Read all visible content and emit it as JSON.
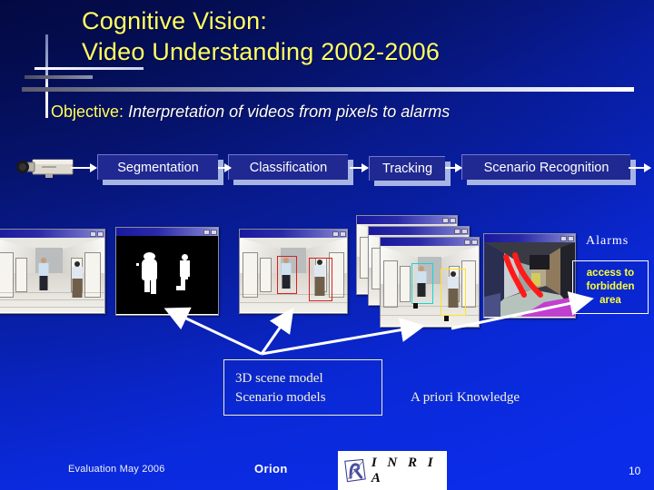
{
  "slide": {
    "title_line1": "Cognitive Vision:",
    "title_line2": "Video Understanding 2002-2006",
    "objective_label": "Objective:",
    "objective_value": "Interpretation of videos from pixels to alarms",
    "background_color": "#0a1f9b",
    "title_color": "#ffff66"
  },
  "pipeline": {
    "source_icon": "video-camera-icon",
    "stages": [
      {
        "label": "Segmentation"
      },
      {
        "label": "Classification"
      },
      {
        "label": "Tracking"
      },
      {
        "label": "Scenario Recognition"
      }
    ]
  },
  "frames": [
    {
      "name": "segmentation-input-frame",
      "caption": "corridor camera view with two people"
    },
    {
      "name": "segmentation-output-frame",
      "caption": "binary motion blobs on black background"
    },
    {
      "name": "classification-frame",
      "caption": "corridor view with red detection boxes"
    },
    {
      "name": "tracking-frame-stack",
      "caption": "stacked tracking windows with cyan and yellow boxes"
    },
    {
      "name": "scenario-3d-frame",
      "caption": "3D scene model with red trajectories"
    }
  ],
  "alarms": {
    "label": "Alarms",
    "message_line1": "access to",
    "message_line2": "forbidden",
    "message_line3": "area",
    "text_color": "#ffff33"
  },
  "knowledge": {
    "model_box_line1": "3D scene model",
    "model_box_line2": "Scenario models",
    "caption": "A priori Knowledge"
  },
  "footer": {
    "event": "Evaluation May 2006",
    "team": "Orion",
    "logo_text": "I N R I A",
    "page_number": "10"
  }
}
